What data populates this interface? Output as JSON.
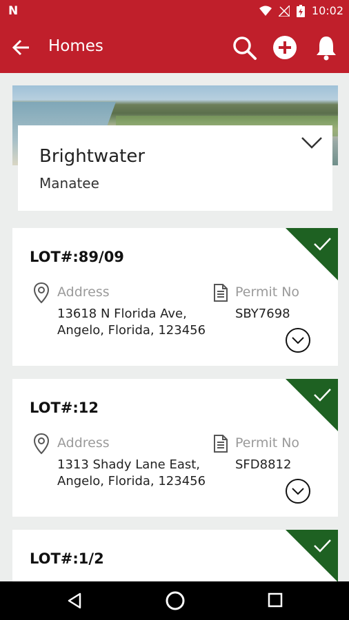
{
  "status_bar": {
    "time": "10:02",
    "notification_glyph": "N",
    "icons": [
      "wifi-icon",
      "signal-off-icon",
      "battery-charging-icon"
    ]
  },
  "app_bar": {
    "title": "Homes",
    "icons": [
      "back-arrow-icon",
      "search-icon",
      "add-circle-icon",
      "bell-icon"
    ]
  },
  "community": {
    "name": "Brightwater",
    "county": "Manatee",
    "icons": [
      "chevron-down-icon"
    ]
  },
  "labels": {
    "address": "Address",
    "permit": "Permit No"
  },
  "lots": [
    {
      "lot": "LOT#:89/09",
      "address_line1": "13618 N Florida Ave,",
      "address_line2": "Angelo, Florida, 123456",
      "permit": "SBY7698"
    },
    {
      "lot": "LOT#:12",
      "address_line1": "1313 Shady Lane East,",
      "address_line2": "Angelo, Florida, 123456",
      "permit": "SFD8812"
    },
    {
      "lot": "LOT#:1/2"
    }
  ],
  "colors": {
    "primary": "#c01f2b",
    "complete": "#1e6122",
    "background": "#eceeed"
  }
}
